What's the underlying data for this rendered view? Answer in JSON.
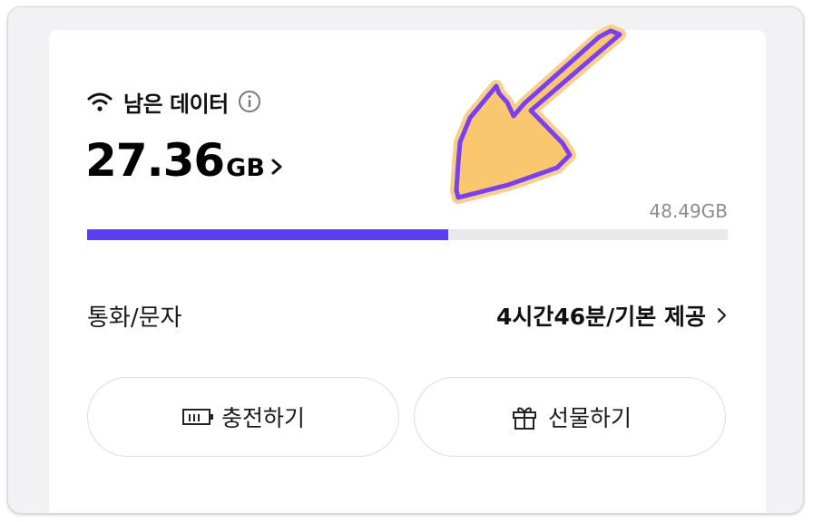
{
  "data_section": {
    "title": "남은 데이터",
    "remaining_value": "27.36",
    "remaining_unit": "GB",
    "total": "48.49GB",
    "usage_fraction": 0.564
  },
  "call_section": {
    "label": "통화/문자",
    "value": "4시간46분/기본 제공"
  },
  "buttons": {
    "charge": "충전하기",
    "gift": "선물하기"
  },
  "colors": {
    "progress_fill": "#5a3ff0",
    "annotation_arrow_fill": "#f9c76e",
    "annotation_arrow_outline": "#7a40f0"
  },
  "icons": {
    "header": "wifi-icon",
    "info": "info-icon",
    "charge": "battery-icon",
    "gift": "gift-icon",
    "chevron": "chevron-right-icon"
  }
}
